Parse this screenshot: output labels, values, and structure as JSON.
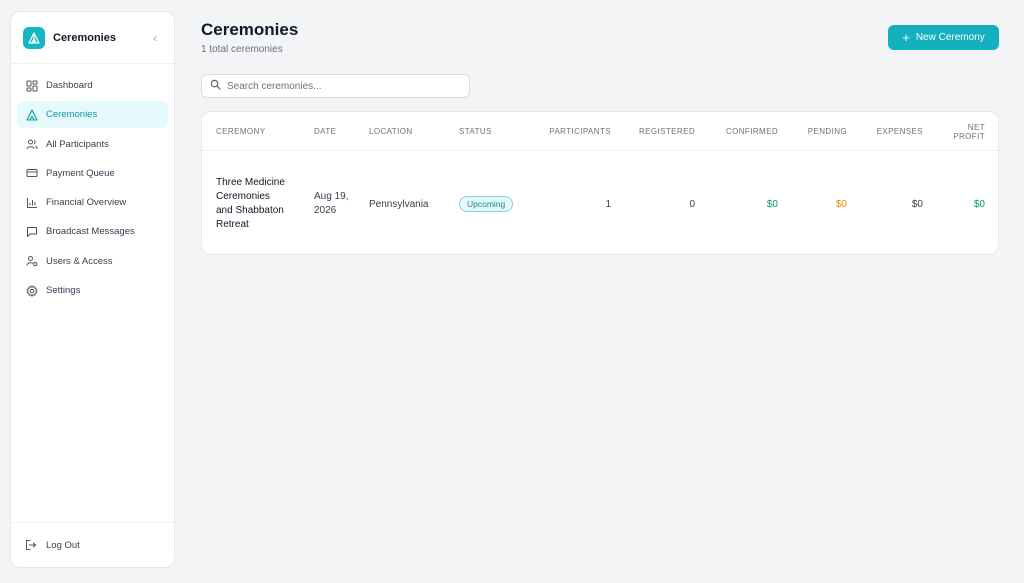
{
  "sidebar": {
    "brand_title": "Ceremonies",
    "items": [
      {
        "label": "Dashboard",
        "icon": "dashboard-icon"
      },
      {
        "label": "Ceremonies",
        "icon": "tent-icon"
      },
      {
        "label": "All Participants",
        "icon": "users-icon"
      },
      {
        "label": "Payment Queue",
        "icon": "credit-card-icon"
      },
      {
        "label": "Financial Overview",
        "icon": "bar-chart-icon"
      },
      {
        "label": "Broadcast Messages",
        "icon": "message-icon"
      },
      {
        "label": "Users & Access",
        "icon": "user-key-icon"
      },
      {
        "label": "Settings",
        "icon": "gear-icon"
      }
    ],
    "active_item": "Ceremonies",
    "logout_label": "Log Out"
  },
  "header": {
    "title": "Ceremonies",
    "subtitle": "1 total ceremonies",
    "new_button_label": "New Ceremony"
  },
  "search": {
    "placeholder": "Search ceremonies...",
    "value": ""
  },
  "table": {
    "columns": [
      "Ceremony",
      "Date",
      "Location",
      "Status",
      "Participants",
      "Registered",
      "Confirmed",
      "Pending",
      "Expenses",
      "Net Profit"
    ],
    "rows": [
      {
        "ceremony": "Three Medicine Ceremonies and Shabbaton Retreat",
        "date": "Aug 19, 2026",
        "location": "Pennsylvania",
        "status": "Upcoming",
        "participants": "1",
        "registered": "0",
        "confirmed": "$0",
        "pending": "$0",
        "expenses": "$0",
        "net_profit": "$0"
      }
    ]
  },
  "colors": {
    "accent": "#14b0bd",
    "active_bg": "#e6fafb",
    "positive": "#059669",
    "pending": "#ea8a10"
  }
}
